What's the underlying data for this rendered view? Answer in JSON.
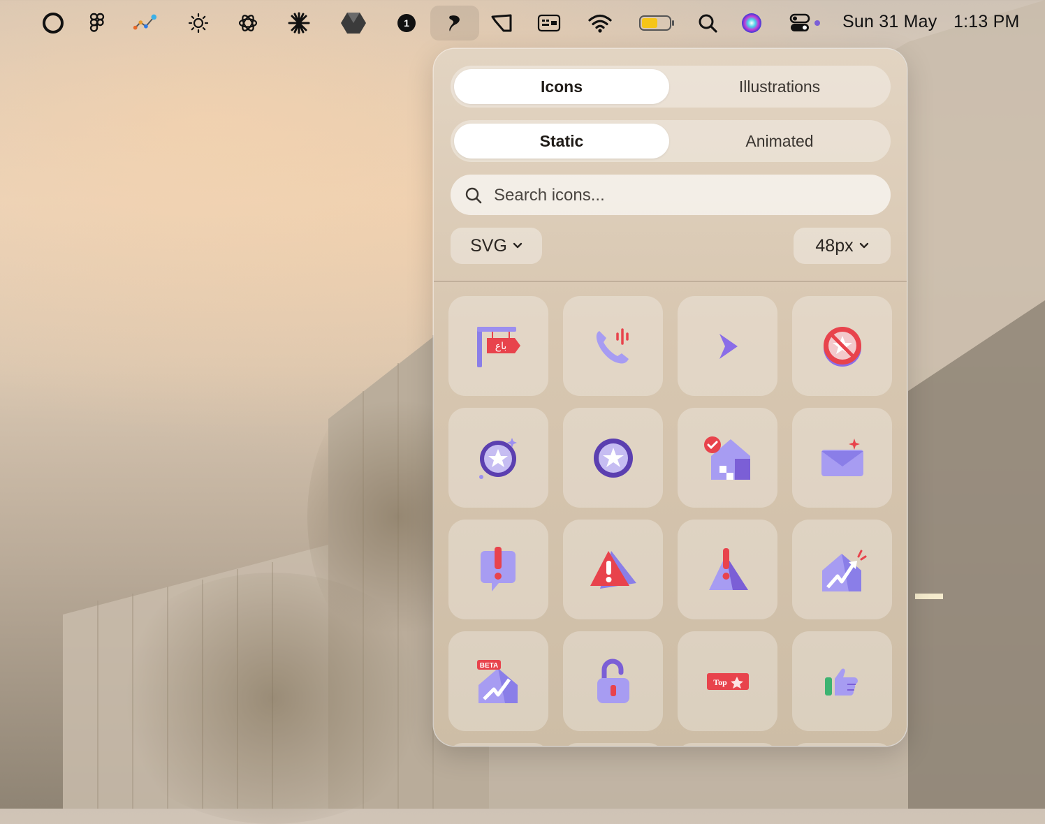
{
  "menubar": {
    "icons": [
      "circle-app-icon",
      "figma-icon",
      "node-graph-icon",
      "brightness-icon",
      "openai-icon",
      "claude-icon",
      "hexagon-app-icon",
      "one-password-icon",
      "iconly-app-icon",
      "notch-app-icon",
      "keyboard-icon",
      "wifi-icon",
      "battery-icon",
      "spotlight-icon",
      "siri-icon",
      "control-center-icon"
    ],
    "date": "Sun 31 May",
    "time": "1:13 PM"
  },
  "popover": {
    "type_tabs": [
      {
        "label": "Icons",
        "selected": true
      },
      {
        "label": "Illustrations",
        "selected": false
      }
    ],
    "mode_tabs": [
      {
        "label": "Static",
        "selected": true
      },
      {
        "label": "Animated",
        "selected": false
      }
    ],
    "search": {
      "placeholder": "Search icons...",
      "value": ""
    },
    "format": {
      "value": "SVG"
    },
    "size": {
      "value": "48px"
    },
    "icons": [
      {
        "name": "sale-sign-icon",
        "text": "باع"
      },
      {
        "name": "phone-call-icon"
      },
      {
        "name": "chevron-right-icon"
      },
      {
        "name": "no-award-icon"
      },
      {
        "name": "award-badge-sparkle-icon"
      },
      {
        "name": "award-badge-icon"
      },
      {
        "name": "house-check-icon"
      },
      {
        "name": "mail-sparkle-icon"
      },
      {
        "name": "alert-message-icon"
      },
      {
        "name": "warning-triangle-icon"
      },
      {
        "name": "warning-sign-icon"
      },
      {
        "name": "house-growth-icon"
      },
      {
        "name": "house-growth-beta-icon",
        "text": "BETA"
      },
      {
        "name": "unlocked-padlock-icon"
      },
      {
        "name": "top-ticket-icon",
        "text": "Top"
      },
      {
        "name": "thumbs-up-icon"
      }
    ]
  },
  "colors": {
    "accent_purple": "#7b5fd6",
    "alert_red": "#e8434c",
    "popover_bg": "#dccbb6"
  }
}
